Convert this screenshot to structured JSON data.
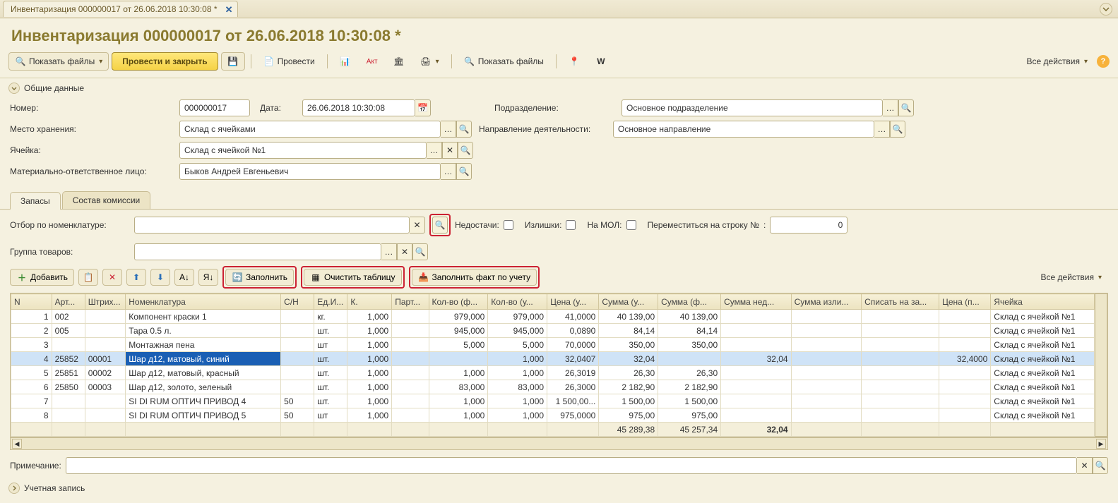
{
  "tab": {
    "title": "Инвентаризация 000000017 от 26.06.2018 10:30:08 *"
  },
  "header": {
    "title": "Инвентаризация 000000017 от 26.06.2018 10:30:08 *"
  },
  "toolbar": {
    "show_files": "Показать файлы",
    "post_and_close": "Провести и закрыть",
    "post": "Провести",
    "show_files2": "Показать файлы",
    "all_actions": "Все действия"
  },
  "sections": {
    "general": "Общие данные",
    "accounting": "Учетная запись"
  },
  "form": {
    "number_label": "Номер:",
    "number": "000000017",
    "date_label": "Дата:",
    "date": "26.06.2018 10:30:08",
    "dept_label": "Подразделение:",
    "dept": "Основное подразделение",
    "store_label": "Место хранения:",
    "store": "Склад с ячейками",
    "activity_label": "Направление деятельности:",
    "activity": "Основное направление",
    "cell_label": "Ячейка:",
    "cell": "Склад с ячейкой №1",
    "mol_label": "Материально-ответственное лицо:",
    "mol": "Быков Андрей Евгеньевич"
  },
  "subtabs": {
    "stocks": "Запасы",
    "commission": "Состав комиссии"
  },
  "filter": {
    "by_nomen_label": "Отбор по номенклатуре:",
    "shortage_label": "Недостачи:",
    "surplus_label": "Излишки:",
    "by_mol_label": "На МОЛ:",
    "goto_row_label": "Переместиться на строку №",
    "goto_row_value": "0",
    "group_label": "Группа товаров:"
  },
  "gridbar": {
    "add": "Добавить",
    "fill": "Заполнить",
    "clear": "Очистить таблицу",
    "fill_fact": "Заполнить факт по учету",
    "all_actions": "Все действия"
  },
  "columns": [
    "N",
    "Арт...",
    "Штрих...",
    "Номенклатура",
    "С/Н",
    "Ед.И...",
    "К.",
    "Парт...",
    "Кол-во (ф...",
    "Кол-во (у...",
    "Цена (у...",
    "Сумма (у...",
    "Сумма (ф...",
    "Сумма нед...",
    "Сумма изли...",
    "Списать на за...",
    "Цена (п...",
    "Ячейка"
  ],
  "rows": [
    {
      "n": "1",
      "art": "002",
      "bar": "",
      "nom": "Компонент краски 1",
      "sn": "",
      "unit": "кг.",
      "k": "1,000",
      "part": "",
      "qf": "979,000",
      "qu": "979,000",
      "pu": "41,0000",
      "su": "40 139,00",
      "sf": "40 139,00",
      "snd": "",
      "sis": "",
      "wo": "",
      "pp": "",
      "cell": "Склад с ячейкой №1"
    },
    {
      "n": "2",
      "art": "005",
      "bar": "",
      "nom": "Тара 0.5 л.",
      "sn": "",
      "unit": "шт.",
      "k": "1,000",
      "part": "",
      "qf": "945,000",
      "qu": "945,000",
      "pu": "0,0890",
      "su": "84,14",
      "sf": "84,14",
      "snd": "",
      "sis": "",
      "wo": "",
      "pp": "",
      "cell": "Склад с ячейкой №1"
    },
    {
      "n": "3",
      "art": "",
      "bar": "",
      "nom": "Монтажная пена",
      "sn": "",
      "unit": "шт",
      "k": "1,000",
      "part": "",
      "qf": "5,000",
      "qu": "5,000",
      "pu": "70,0000",
      "su": "350,00",
      "sf": "350,00",
      "snd": "",
      "sis": "",
      "wo": "",
      "pp": "",
      "cell": "Склад с ячейкой №1"
    },
    {
      "n": "4",
      "art": "25852",
      "bar": "00001",
      "nom": "Шар д12, матовый, синий",
      "sn": "",
      "unit": "шт.",
      "k": "1,000",
      "part": "",
      "qf": "",
      "qu": "1,000",
      "pu": "32,0407",
      "su": "32,04",
      "sf": "",
      "snd": "32,04",
      "sis": "",
      "wo": "",
      "pp": "32,4000",
      "cell": "Склад с ячейкой №1",
      "selected": true
    },
    {
      "n": "5",
      "art": "25851",
      "bar": "00002",
      "nom": "Шар д12, матовый, красный",
      "sn": "",
      "unit": "шт.",
      "k": "1,000",
      "part": "",
      "qf": "1,000",
      "qu": "1,000",
      "pu": "26,3019",
      "su": "26,30",
      "sf": "26,30",
      "snd": "",
      "sis": "",
      "wo": "",
      "pp": "",
      "cell": "Склад с ячейкой №1"
    },
    {
      "n": "6",
      "art": "25850",
      "bar": "00003",
      "nom": "Шар д12, золото, зеленый",
      "sn": "",
      "unit": "шт.",
      "k": "1,000",
      "part": "",
      "qf": "83,000",
      "qu": "83,000",
      "pu": "26,3000",
      "su": "2 182,90",
      "sf": "2 182,90",
      "snd": "",
      "sis": "",
      "wo": "",
      "pp": "",
      "cell": "Склад с ячейкой №1"
    },
    {
      "n": "7",
      "art": "",
      "bar": "",
      "nom": "SI DI RUM ОПТИЧ ПРИВОД 4",
      "sn": "50",
      "unit": "шт.",
      "k": "1,000",
      "part": "",
      "qf": "1,000",
      "qu": "1,000",
      "pu": "1 500,00...",
      "su": "1 500,00",
      "sf": "1 500,00",
      "snd": "",
      "sis": "",
      "wo": "",
      "pp": "",
      "cell": "Склад с ячейкой №1"
    },
    {
      "n": "8",
      "art": "",
      "bar": "",
      "nom": "SI DI RUM ОПТИЧ ПРИВОД 5",
      "sn": "50",
      "unit": "шт",
      "k": "1,000",
      "part": "",
      "qf": "1,000",
      "qu": "1,000",
      "pu": "975,0000",
      "su": "975,00",
      "sf": "975,00",
      "snd": "",
      "sis": "",
      "wo": "",
      "pp": "",
      "cell": "Склад с ячейкой №1"
    }
  ],
  "totals": {
    "su": "45 289,38",
    "sf": "45 257,34",
    "snd": "32,04"
  },
  "note_label": "Примечание:"
}
